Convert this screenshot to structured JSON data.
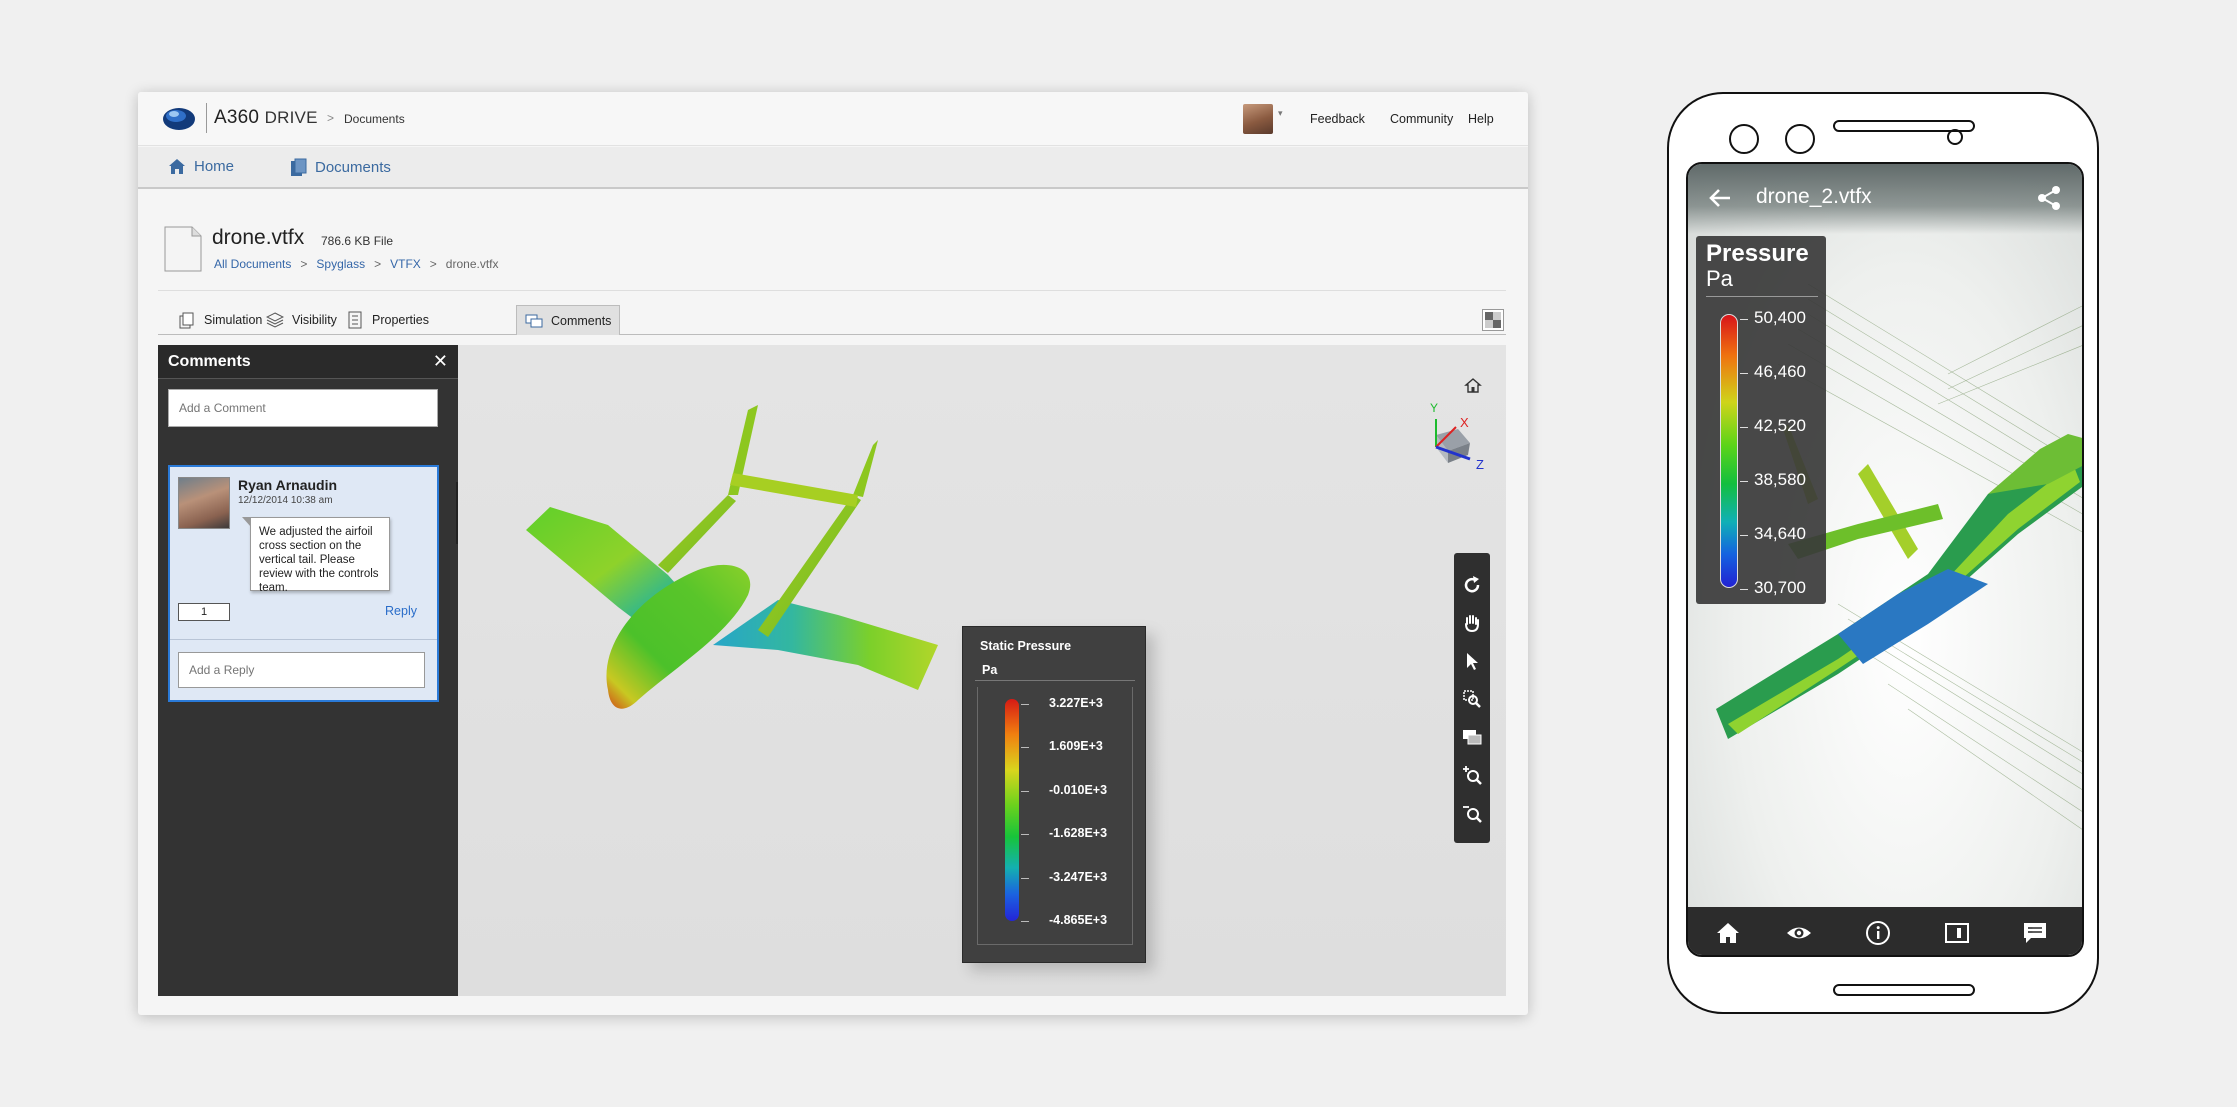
{
  "desktop": {
    "brand": "A360",
    "brand_sub": "DRIVE",
    "breadcrumb_sep": ">",
    "breadcrumb_current": "Documents",
    "top_links": [
      "Feedback",
      "Community",
      "Help"
    ],
    "nav": {
      "home": "Home",
      "documents": "Documents"
    },
    "file": {
      "name": "drone.vtfx",
      "size": "786.6 KB File",
      "crumbs": [
        "All Documents",
        ">",
        "Spyglass",
        ">",
        "VTFX",
        ">",
        "drone.vtfx"
      ]
    },
    "tabs": [
      "Simulation",
      "Visibility",
      "Properties",
      "Comments"
    ],
    "active_tab": "Comments",
    "comments": {
      "title": "Comments",
      "close": "✕",
      "add_placeholder": "Add a Comment",
      "item": {
        "author": "Ryan Arnaudin",
        "date": "12/12/2014 10:38 am",
        "text": "We adjusted the airfoil cross section on the vertical tail. Please review with the controls team.",
        "count": "1",
        "reply_label": "Reply",
        "reply_placeholder": "Add a Reply"
      }
    },
    "axes": {
      "x": "X",
      "y": "Y",
      "z": "Z"
    },
    "legend": {
      "title": "Static Pressure",
      "unit": "Pa",
      "values": [
        "3.227E+3",
        "1.609E+3",
        "-0.010E+3",
        "-1.628E+3",
        "-3.247E+3",
        "-4.865E+3"
      ]
    },
    "tools": [
      "rotate-icon",
      "pan-hand-icon",
      "select-pointer-icon",
      "zoom-window-icon",
      "comment-icon",
      "zoom-in-icon",
      "zoom-out-icon"
    ]
  },
  "phone": {
    "title": "drone_2.vtfx",
    "legend": {
      "title": "Pressure",
      "unit": "Pa",
      "values": [
        "50,400",
        "46,460",
        "42,520",
        "38,580",
        "34,640",
        "30,700"
      ]
    },
    "nav_icons": [
      "home-icon",
      "eye-icon",
      "info-icon",
      "section-icon",
      "comments-icon"
    ]
  },
  "colors": {
    "link": "#3466a8",
    "accent_blue": "#2a7ad8",
    "panel_dark": "#333333"
  }
}
